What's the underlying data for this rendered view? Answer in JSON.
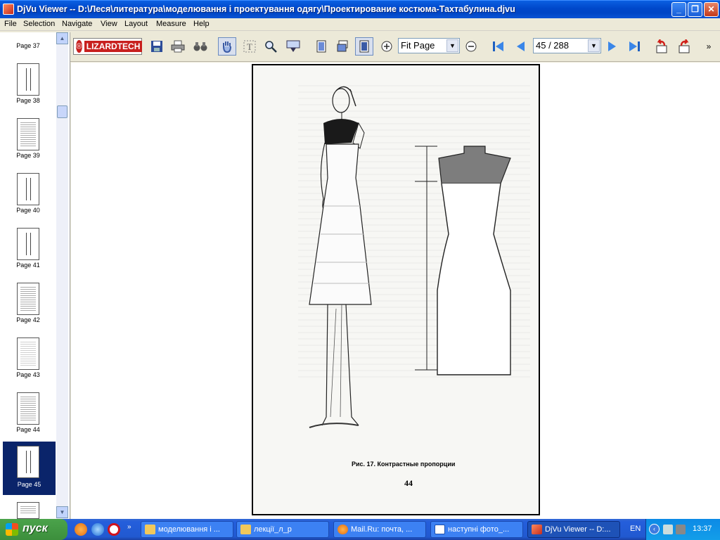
{
  "window": {
    "title": "DjVu Viewer -- D:\\Леся\\литература\\моделювання і проектування одягу\\Проектирование костюма-Тахтабулина.djvu",
    "minimize": "_",
    "maximize": "❐",
    "close": "✕"
  },
  "menu": [
    "File",
    "Selection",
    "Navigate",
    "View",
    "Layout",
    "Measure",
    "Help"
  ],
  "toolbar": {
    "logo": "LIZARDTECH",
    "zoom_value": "Fit Page",
    "page_value": "45 / 288"
  },
  "sidebar": {
    "pages": [
      "Page 37",
      "Page 38",
      "Page 39",
      "Page 40",
      "Page 41",
      "Page 42",
      "Page 43",
      "Page 44"
    ],
    "selected": "Page 45"
  },
  "document": {
    "caption": "Рис. 17. Контрастные пропорции",
    "page_number": "44"
  },
  "taskbar": {
    "start": "пуск",
    "tasks": [
      "моделювання і ...",
      "лекції_л_р",
      "Mail.Ru: почта, ...",
      "наступні фото_...",
      "DjVu Viewer -- D:..."
    ],
    "active_task": 4,
    "language": "EN",
    "time": "13:37"
  }
}
